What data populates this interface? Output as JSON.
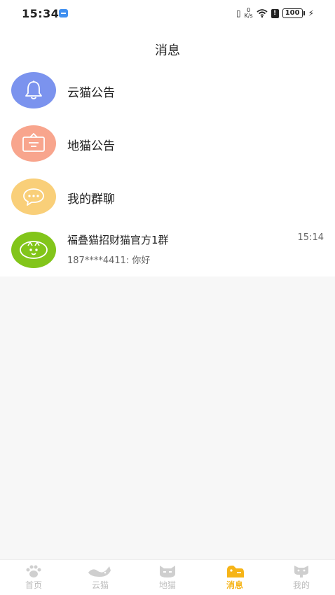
{
  "status_bar": {
    "time": "15:34",
    "network_speed_value": "0",
    "network_speed_unit": "K/s",
    "battery": "100"
  },
  "header": {
    "title": "消息"
  },
  "system_rows": [
    {
      "label": "云猫公告",
      "icon": "bell-icon",
      "color": "#7b93ee"
    },
    {
      "label": "地猫公告",
      "icon": "notice-board-icon",
      "color": "#f8a58d"
    },
    {
      "label": "我的群聊",
      "icon": "chat-bubble-icon",
      "color": "#f9cf79"
    }
  ],
  "chat": {
    "name": "福叠猫招财猫官方1群",
    "time": "15:14",
    "preview": "187****4411: 你好",
    "avatar_color": "#82c51a"
  },
  "tabbar": {
    "items": [
      {
        "label": "首页",
        "icon": "paw-icon",
        "active": false
      },
      {
        "label": "云猫",
        "icon": "cat-tail-icon",
        "active": false
      },
      {
        "label": "地猫",
        "icon": "cat-face-icon",
        "active": false
      },
      {
        "label": "消息",
        "icon": "message-cat-icon",
        "active": true
      },
      {
        "label": "我的",
        "icon": "cat-profile-icon",
        "active": false
      }
    ],
    "active_color": "#f6b417",
    "inactive_color": "#bdbdbd"
  }
}
